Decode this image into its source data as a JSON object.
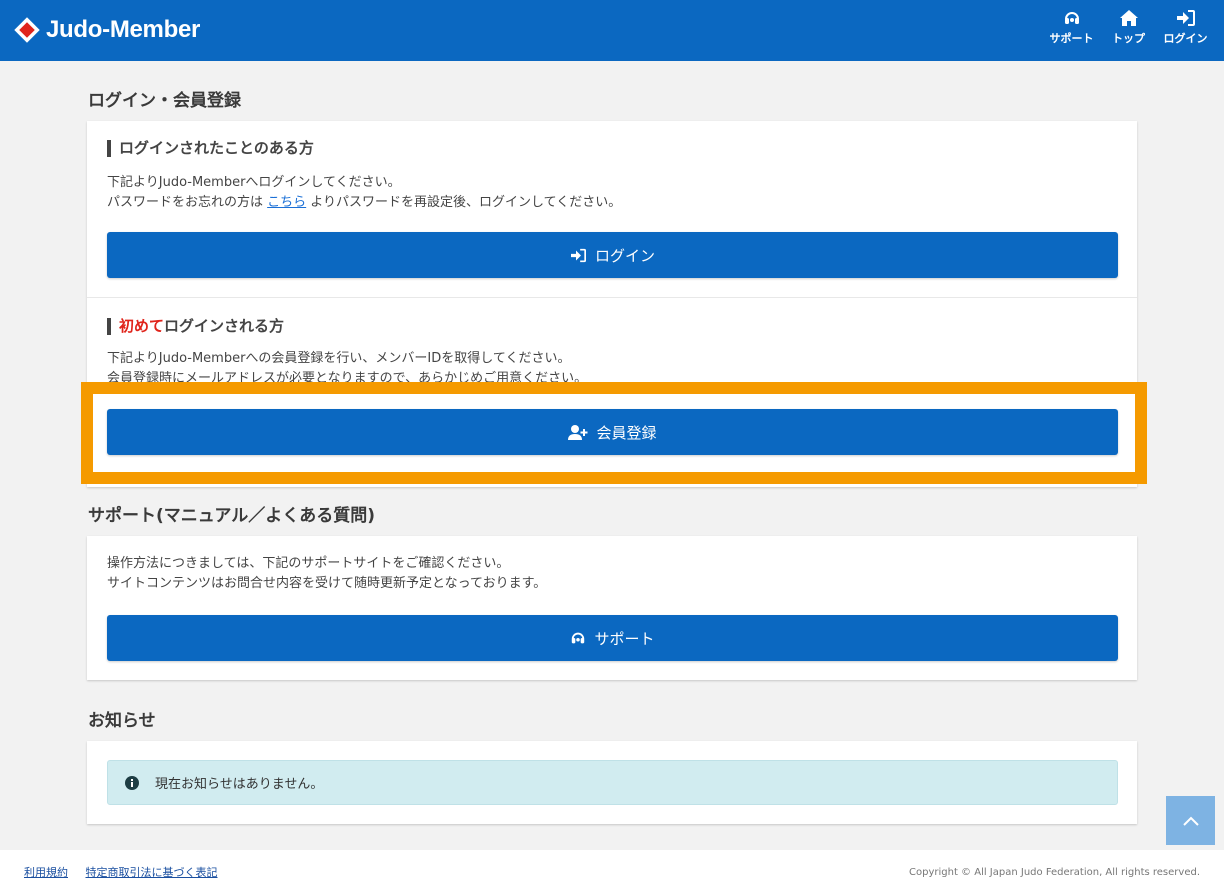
{
  "header": {
    "brand": "Judo-Member",
    "brand_color": "#0b68c1",
    "nav": [
      {
        "label": "サポート",
        "icon": "headset-icon"
      },
      {
        "label": "トップ",
        "icon": "home-icon"
      },
      {
        "label": "ログイン",
        "icon": "sign-in-icon"
      }
    ]
  },
  "login_section": {
    "title": "ログイン・会員登録",
    "existing": {
      "heading": "ログインされたことのある方",
      "line1": "下記よりJudo-Memberへログインしてください。",
      "line2_pre": "パスワードをお忘れの方は ",
      "line2_link": "こちら",
      "line2_post": " よりパスワードを再設定後、ログインしてください。",
      "button": "ログイン"
    },
    "first": {
      "heading_em": "初めて",
      "heading_rest": "ログインされる方",
      "line1": "下記よりJudo-Memberへの会員登録を行い、メンバーIDを取得してください。",
      "line2": "会員登録時にメールアドレスが必要となりますので、あらかじめご用意ください。",
      "button": "会員登録"
    }
  },
  "support_section": {
    "title": "サポート(マニュアル／よくある質問)",
    "line1": "操作方法につきましては、下記のサポートサイトをご確認ください。",
    "line2": "サイトコンテンツはお問合せ内容を受けて随時更新予定となっております。",
    "button": "サポート"
  },
  "news_section": {
    "title": "お知らせ",
    "notice": "現在お知らせはありません。"
  },
  "footer": {
    "links": [
      "利用規約",
      "特定商取引法に基づく表記"
    ],
    "copyright": "Copyright © All Japan Judo Federation, All rights reserved."
  },
  "highlight_color": "#f59a00"
}
